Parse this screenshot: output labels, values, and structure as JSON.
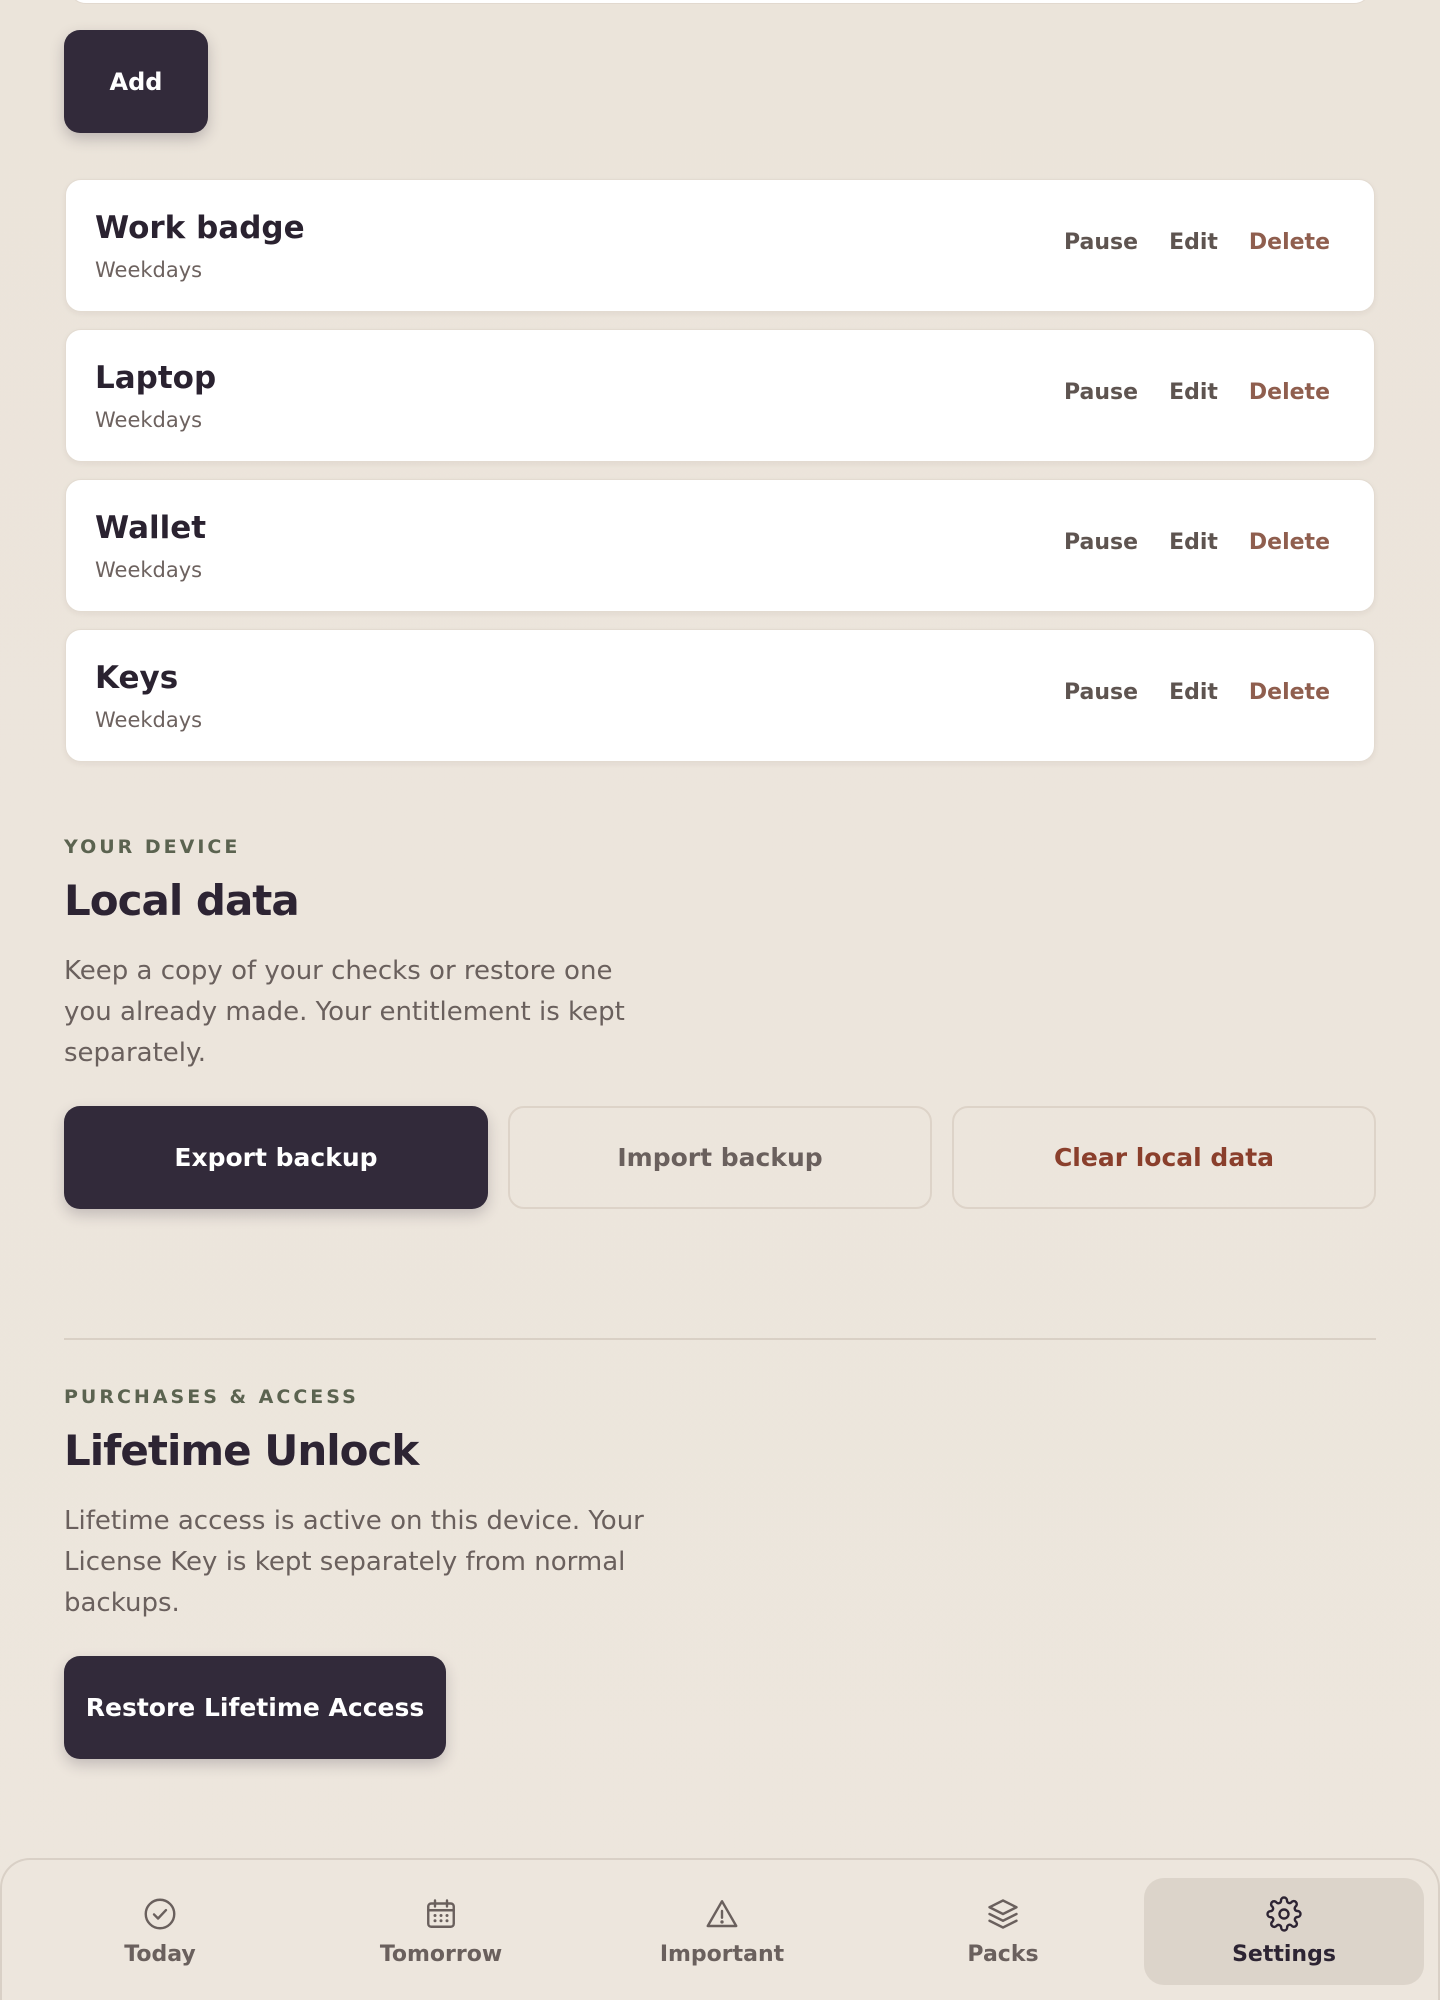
{
  "add_button": {
    "label": "Add"
  },
  "items": [
    {
      "name": "Work badge",
      "schedule": "Weekdays",
      "pause": "Pause",
      "edit": "Edit",
      "delete": "Delete"
    },
    {
      "name": "Laptop",
      "schedule": "Weekdays",
      "pause": "Pause",
      "edit": "Edit",
      "delete": "Delete"
    },
    {
      "name": "Wallet",
      "schedule": "Weekdays",
      "pause": "Pause",
      "edit": "Edit",
      "delete": "Delete"
    },
    {
      "name": "Keys",
      "schedule": "Weekdays",
      "pause": "Pause",
      "edit": "Edit",
      "delete": "Delete"
    }
  ],
  "local_data": {
    "eyebrow": "YOUR DEVICE",
    "title": "Local data",
    "description": "Keep a copy of your checks or restore one you already made. Your entitlement is kept separately.",
    "export_label": "Export backup",
    "import_label": "Import backup",
    "clear_label": "Clear local data"
  },
  "purchases": {
    "eyebrow": "PURCHASES & ACCESS",
    "title": "Lifetime Unlock",
    "description": "Lifetime access is active on this device. Your License Key is kept separately from normal backups.",
    "restore_label": "Restore Lifetime Access"
  },
  "nav": {
    "items": [
      {
        "label": "Today",
        "icon": "check-circle-icon"
      },
      {
        "label": "Tomorrow",
        "icon": "calendar-icon"
      },
      {
        "label": "Important",
        "icon": "warning-icon"
      },
      {
        "label": "Packs",
        "icon": "layers-icon"
      },
      {
        "label": "Settings",
        "icon": "gear-icon"
      }
    ],
    "active": "Settings"
  },
  "colors": {
    "background": "#ebe4da",
    "primary_button": "#322a3a",
    "danger_text": "#8a3f2c",
    "delete_text": "#8f5e4e",
    "eyebrow": "#5b6350"
  }
}
